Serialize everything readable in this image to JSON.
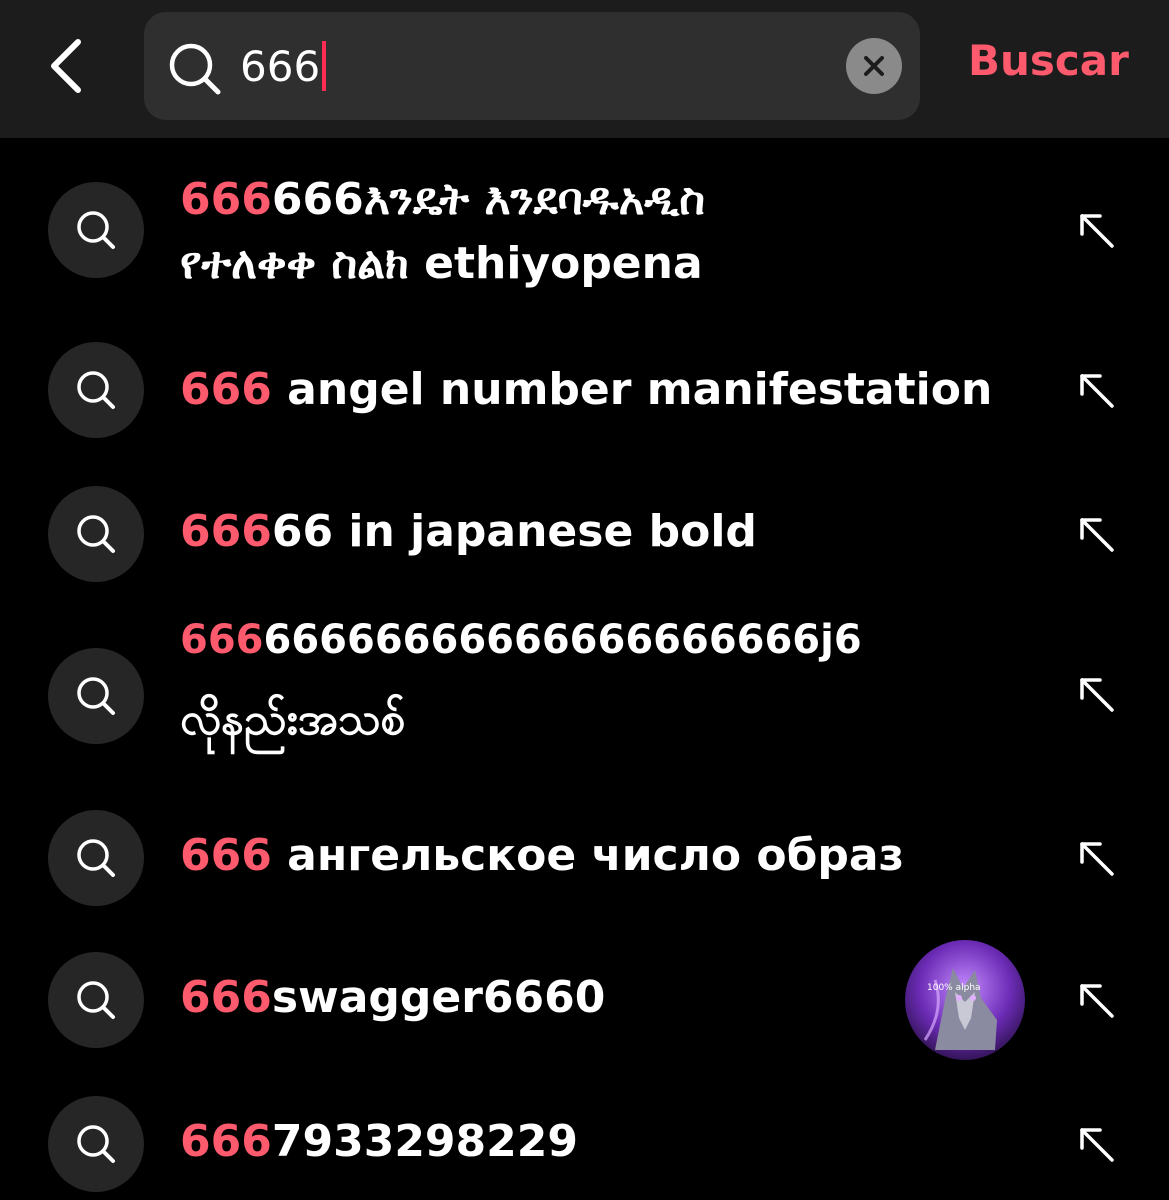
{
  "header": {
    "back_icon": "chevron-left-icon",
    "search": {
      "value": "666",
      "icon": "search-icon",
      "clear_icon": "clear-icon"
    },
    "submit_label": "Buscar"
  },
  "colors": {
    "highlight": "#fe5a6d",
    "header_bg": "#1c1c1c",
    "input_bg": "#2f2f2f",
    "caret": "#fe2c55"
  },
  "suggestions": [
    {
      "highlight": "666",
      "rest": "666እንዴት እንደባዱአዲስ",
      "line2": "የተለቀቀ ስልክ ethiyopena"
    },
    {
      "highlight": "666",
      "rest": " angel number manifestation",
      "line2": ""
    },
    {
      "highlight": "666",
      "rest": "66 in japanese bold",
      "line2": ""
    },
    {
      "highlight": "666",
      "rest": "66666666666666666666j6",
      "line2": "လိုနည်းအသစ်"
    },
    {
      "highlight": "666",
      "rest": " ангельское число образ",
      "line2": ""
    },
    {
      "highlight": "666",
      "rest": "swagger6660",
      "line2": "",
      "avatar_text": "100% alpha"
    },
    {
      "highlight": "666",
      "rest": "7933298229",
      "line2": ""
    }
  ]
}
